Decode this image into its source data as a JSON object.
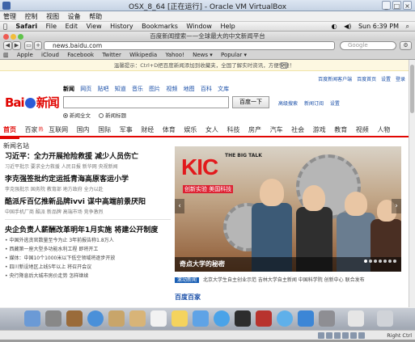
{
  "vbox": {
    "title": "OSX_8_64 [正在运行] - Oracle VM VirtualBox",
    "menu": [
      "管理",
      "控制",
      "视图",
      "设备",
      "帮助"
    ],
    "host_key": "Right Ctrl"
  },
  "macbar": {
    "app": "Safari",
    "menu": [
      "File",
      "Edit",
      "View",
      "History",
      "Bookmarks",
      "Window",
      "Help"
    ],
    "clock": "Sun 6:39 PM"
  },
  "safari": {
    "title": "百度新闻搜索——全球最大的中文新闻平台",
    "url": "news.baidu.com",
    "search_placeholder": "Google",
    "bookmarks": [
      "Apple",
      "iCloud",
      "Facebook",
      "Twitter",
      "Wikipedia",
      "Yahoo!",
      "News ▾",
      "Popular ▾"
    ]
  },
  "page": {
    "notice": "温馨提示：Ctrl+D把百度新闻添加到收藏夹，全国了解实时资讯，方便快捷！",
    "toplinks": [
      "百度新闻客户端",
      "百度首页",
      "设置",
      "登录"
    ],
    "search": {
      "tabs": [
        "新闻",
        "网页",
        "贴吧",
        "知道",
        "音乐",
        "图片",
        "视频",
        "地图",
        "百科",
        "文库"
      ],
      "button": "百度一下",
      "links": [
        "高级搜索",
        "新闻订阅",
        "设置"
      ],
      "opt1": "新闻全文",
      "opt2": "新闻标题"
    },
    "nav": [
      "首页",
      "百家",
      "互联网",
      "国内",
      "国际",
      "军事",
      "财经",
      "体育",
      "娱乐",
      "女人",
      "科技",
      "房产",
      "汽车",
      "社会",
      "游戏",
      "教育",
      "视频",
      "人物",
      "新闻名站"
    ],
    "nav_hot": "热",
    "news": [
      {
        "h": "习近平：全力开展抢险救援 减少人员伤亡",
        "s": "习近平批示 要求全力救援 人民日报 新华网 央视新闻"
      },
      {
        "h": "李克强签批约定运抵青海高原客运小学",
        "s": "李克强批示 国务院 教育部 地方政府 全力以赴"
      },
      {
        "h": "酷派斥百亿推新品牌ivvi 谋中高端前景厌阳",
        "s": "中国手机厂商 酷派 新品牌 高端市场 竞争激烈"
      },
      {
        "h": "央企负责人薪酬改革明年1月实施 将建公开制度",
        "s": ""
      }
    ],
    "list": [
      "中国外逃贪官数量至今为止 3年前报告称1.8万人",
      "西藏第一座大型多功能水利工程 即将开工",
      "媒体：中国10个1000米以下低空领域将逐步开放",
      "四川新设地区上线5年以上 将召开会议",
      "央行降息后大城市房价走势 怎样继续"
    ],
    "banner": {
      "brand": "KIC",
      "brand_sub": "THE BIG TALK",
      "tagline": "创新实验 美国科技",
      "caption": "奇点大学的秘密"
    },
    "live_tag": "滚动新闻",
    "live_text": "北京大学生自主创业示范 吉林大学自主新闻 中国科学院 创新中心 联合发布",
    "bottom": "百度百家"
  }
}
